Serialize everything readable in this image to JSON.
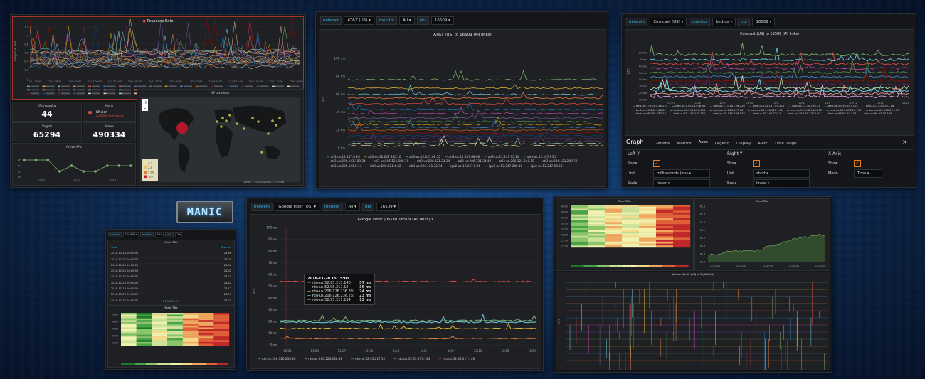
{
  "branding": {
    "logo_text": "MANIC"
  },
  "panel_topleft": {
    "response_title": "Response Rate",
    "ylabel": "Response rate",
    "yticks": [
      "1.2",
      "1",
      "0.8",
      "0.6",
      "0.4",
      "0.2",
      "0"
    ],
    "xticks": [
      "12/11 12:00",
      "12/12 00:00",
      "12/12 12:00",
      "12/13 00:00",
      "12/13 12:00",
      "12/14 00:00",
      "12/14 12:00",
      "12/15 00:00",
      "12/15 12:00",
      "12/16 00:00",
      "12/16 12:00",
      "12/17 00:00",
      "12/17 12:00",
      "12/18 00:00"
    ],
    "stats": {
      "vps_reporting_label": "VPs reporting",
      "vps_reporting_value": "44",
      "alerts_label": "Alerts",
      "alert_name": "RR alert",
      "alert_state": "ALERTING for 9 months",
      "targets_label": "Targets",
      "targets_value": "65294",
      "probes_label": "Probes",
      "probes_value": "490334"
    },
    "active_vps_title": "Active VP's",
    "active_vps_yticks": [
      "45",
      "44",
      "43",
      "42"
    ],
    "active_vps_xticks": [
      "12/13",
      "12/15",
      "12/17"
    ],
    "active_vps_values": [
      45,
      45,
      45,
      43,
      44,
      43,
      43,
      44,
      44,
      44
    ],
    "vp_locations_title": "VP Locations",
    "map_legend": [
      "< 2",
      "2-5",
      "5-10",
      "10+"
    ],
    "map_attrib": "Leaflet | © OpenStreetMap © CartoDB"
  },
  "panel_att": {
    "network_label": "network",
    "network_value": "AT&T (US)",
    "monitor_label": "monitor",
    "monitor_value": "All",
    "nbr_label": "nbr",
    "nbr_value": "16509",
    "title": "AT&T (US) to 16509 (All links)",
    "ylabel": "RTT",
    "yticks": [
      "100 ms",
      "80 ms",
      "60 ms",
      "40 ms",
      "20 ms",
      "0 ms"
    ],
    "xticks": [
      "12/11 00:00",
      "12/12 00:00",
      "12/13 00:00",
      "12/14 00:00",
      "12/15 00:00",
      "12/16 00:00",
      "12/17 00:00"
    ],
    "legend": [
      "atl3-us:12.247.0.26",
      "atl3-us:12.247.240.10",
      "atl3-us:12.247.68.50",
      "atl3-us:12.247.68.66",
      "atl3-us:12.247.95.10",
      "atl3-us:12.247.95.6",
      "atl3-us:206.121.188.34",
      "atl3-us:206.121.188.70",
      "atl3-us:206.121.24.34",
      "atl3-us:206.121.24.42",
      "atl3-us:206.121.240.10",
      "atl3-us:206.121.240.70",
      "atl3-us:206.121.6.14",
      "atl3-us:206.121.6.62",
      "atl3-us:206.121.72.34",
      "lga2-us:12.247.0.26",
      "lga2-us:12.247.240.10",
      "lga2-us:12.247.68.50"
    ]
  },
  "panel_comcast": {
    "network_label": "network",
    "network_value": "Comcast (US)",
    "monitor_label": "monitor",
    "monitor_value": "bed-us",
    "nbr_label": "nbr",
    "nbr_value": "16509",
    "title": "Comcast (US) to 16509 (All links)",
    "ylabel": "RTT",
    "yticks": [
      "80 ms",
      "70 ms",
      "60 ms",
      "50 ms",
      "40 ms",
      "30 ms",
      "20 ms",
      "10 ms"
    ],
    "xticks": [
      "11/21",
      "11/24",
      "11/27",
      "11/30",
      "12/3",
      "12/6",
      "12/9",
      "12/12",
      "12/15",
      "12/18"
    ],
    "legend": [
      "bed-us:173.167.58.214",
      "bed-us:173.167.58.66",
      "bed-us:173.167.59.210",
      "bed-us:173.167.59.214",
      "bed-us:23.30.206.34",
      "bed-us:23.30.207.114",
      "bed-us:23.30.207.26",
      "bed-us:50.242.148.62",
      "bed-us:50.242.150.146",
      "bed-us:50.248.117.66",
      "bed-us:50.248.118.190",
      "bed-us:50.248.118.202",
      "bed-us:66.208.229.190",
      "bed-us:66.208.229.30",
      "bed-us:66.208.233.18",
      "bed-us:75.149.228.150",
      "bed-us:75.149.228.178",
      "bed-us:75.149.229.2",
      "bed-us:75.149.230.190",
      "bed-us:96.67.10.158",
      "bed-us:96.67.10.166"
    ],
    "editor_title": "Graph",
    "tabs": [
      "General",
      "Metrics",
      "Axes",
      "Legend",
      "Display",
      "Alert",
      "Time range"
    ],
    "active_tab": "Axes",
    "left_y": {
      "heading": "Left Y",
      "show_label": "Show",
      "unit_label": "Unit",
      "unit_value": "milliseconds (ms)",
      "scale_label": "Scale",
      "scale_value": "linear"
    },
    "right_y": {
      "heading": "Right Y",
      "show_label": "Show",
      "unit_label": "Unit",
      "unit_value": "short",
      "scale_label": "Scale",
      "scale_value": "linear"
    },
    "x_axis": {
      "heading": "X-Axis",
      "show_label": "Show",
      "mode_label": "Mode",
      "mode_value": "Time"
    }
  },
  "panel_google": {
    "network_label": "network",
    "network_value": "Google Fiber (US)",
    "monitor_label": "monitor",
    "monitor_value": "All",
    "nbr_label": "nbr",
    "nbr_value": "16509",
    "title": "Google Fiber (US) to 16509 (All links)",
    "ylabel": "RTT",
    "yticks": [
      "100 ms",
      "90 ms",
      "80 ms",
      "70 ms",
      "60 ms",
      "50 ms",
      "40 ms",
      "30 ms",
      "20 ms",
      "10 ms",
      "0 ms"
    ],
    "xticks": [
      "11/21",
      "11/24",
      "11/27",
      "11/30",
      "12/3",
      "12/6",
      "12/9",
      "12/12",
      "12/15",
      "12/18"
    ],
    "tooltip": {
      "time": "2018-11-20 15:15:00",
      "rows": [
        {
          "name": "rdu-us:52.95.217.146:",
          "value": "57 ms",
          "color": "#e24d42"
        },
        {
          "name": "rdu-us:52.95.217.12:",
          "value": "36 ms",
          "color": "#7eb26d"
        },
        {
          "name": "rdu-us:206.126.236.88:",
          "value": "24 ms",
          "color": "#eab839"
        },
        {
          "name": "rdu-us:206.126.236.26:",
          "value": "23 ms",
          "color": "#6ed0e0"
        },
        {
          "name": "rdu-us:52.95.217.134:",
          "value": "13 ms",
          "color": "#ef843c"
        }
      ]
    },
    "legend": [
      "rdu-us:206.126.236.26",
      "rdu-us:206.126.236.88",
      "rdu-us:52.95.217.12",
      "rdu-us:52.95.217.134",
      "rdu-us:52.95.217.146"
    ]
  },
  "panel_small": {
    "network_label": "network",
    "network_value": "Cox (US)",
    "monitor_label": "monitor",
    "monitor_value": "All",
    "nbr_label": "nbr",
    "nbr_value": "2",
    "table_title": "Panel Title",
    "col_time": "Time",
    "col_val": "N series",
    "rows": [
      [
        "2018-11-28 06:00:00",
        "24.86"
      ],
      [
        "2018-11-28 06:00:00",
        "24.00"
      ],
      [
        "2018-11-28 06:00:00",
        "24.36"
      ],
      [
        "2018-11-28 06:00:00",
        "24.32"
      ],
      [
        "2018-11-28 06:00:00",
        "24.21"
      ],
      [
        "2018-11-28 06:00:00",
        "24.32"
      ],
      [
        "2018-11-28 06:00:00",
        "24.12"
      ],
      [
        "2018-11-28 06:00:00",
        "24.20"
      ],
      [
        "2018-11-28 06:00:00",
        "24.24"
      ]
    ],
    "pager": "1 2 3 4 5 6 7 8",
    "heatmap_title": "Panel Title",
    "heatmap_yticks": [
      "09:00",
      "06:00",
      "03:00",
      "00:00",
      "21:00"
    ]
  },
  "panel_right": {
    "heatmap_title": "Panel Title",
    "heatmap_yticks": [
      "09:00",
      "06:00",
      "03:00",
      "00:00",
      "21:00",
      "18:00",
      "15:00",
      "12:00"
    ],
    "line_title": "Panel Title",
    "line_yticks": [
      "81.8",
      "81.6",
      "81.4",
      "81.2",
      "81.0",
      "80.8",
      "80.6",
      "80.4"
    ],
    "line_xticks": [
      "11:31:00",
      "11:34:00",
      "11:37:00",
      "11:40:00",
      "11:43:00"
    ],
    "bottom_title": "Verizon Nordic (US) to 5 (All links)",
    "bottom_ylabel": "RTT"
  }
}
